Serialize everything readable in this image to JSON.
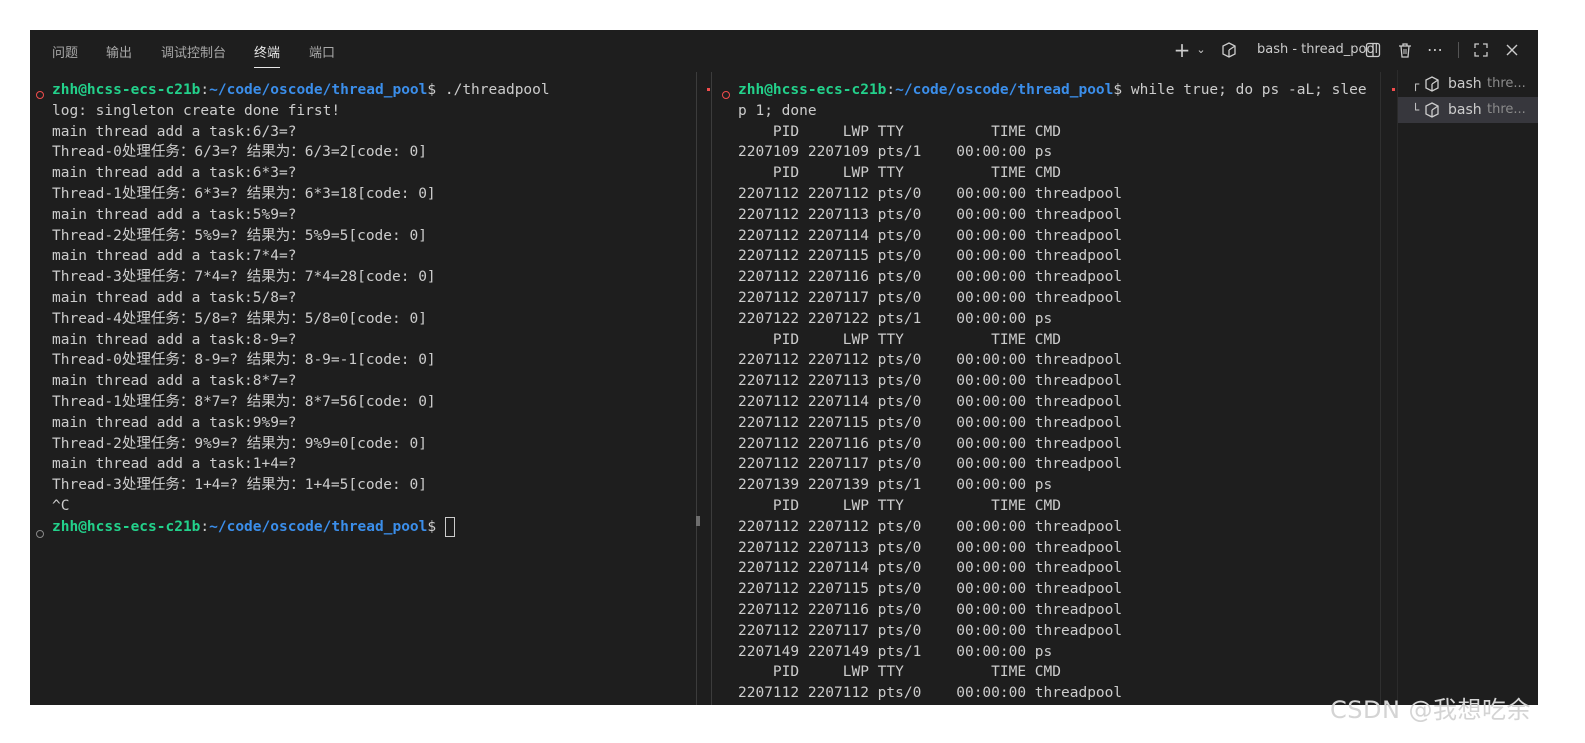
{
  "tabs": [
    {
      "label": "问题",
      "active": false
    },
    {
      "label": "输出",
      "active": false
    },
    {
      "label": "调试控制台",
      "active": false
    },
    {
      "label": "终端",
      "active": true
    },
    {
      "label": "端口",
      "active": false
    }
  ],
  "toolbar": {
    "terminal_name": "bash - thread_pool",
    "icons": [
      "plus-icon",
      "chevron-down-icon",
      "terminal-icon",
      "split-icon",
      "trash-icon",
      "more-icon",
      "maximize-icon",
      "close-icon"
    ]
  },
  "left_pane": {
    "prompt": {
      "user": "zhh@hcss-ecs-c21b",
      "path": "~/code/oscode/thread_pool",
      "suffix": "$"
    },
    "command": " ./threadpool",
    "output": [
      "log: singleton create done first!",
      "main thread add a task:6/3=?",
      "Thread-0处理任务：6/3=? 结果为：6/3=2[code: 0]",
      "main thread add a task:6*3=?",
      "Thread-1处理任务：6*3=? 结果为：6*3=18[code: 0]",
      "main thread add a task:5%9=?",
      "Thread-2处理任务：5%9=? 结果为：5%9=5[code: 0]",
      "main thread add a task:7*4=?",
      "Thread-3处理任务：7*4=? 结果为：7*4=28[code: 0]",
      "main thread add a task:5/8=?",
      "Thread-4处理任务：5/8=? 结果为：5/8=0[code: 0]",
      "main thread add a task:8-9=?",
      "Thread-0处理任务：8-9=? 结果为：8-9=-1[code: 0]",
      "main thread add a task:8*7=?",
      "Thread-1处理任务：8*7=? 结果为：8*7=56[code: 0]",
      "main thread add a task:9%9=?",
      "Thread-2处理任务：9%9=? 结果为：9%9=0[code: 0]",
      "main thread add a task:1+4=?",
      "Thread-3处理任务：1+4=? 结果为：1+4=5[code: 0]",
      "^C"
    ]
  },
  "right_pane": {
    "prompt": {
      "user": "zhh@hcss-ecs-c21b",
      "path": "~/code/oscode/thread_pool",
      "suffix": "$"
    },
    "command": " while true; do ps -aL; slee",
    "command_wrap": "p 1; done",
    "output": [
      "    PID     LWP TTY          TIME CMD",
      "2207109 2207109 pts/1    00:00:00 ps",
      "    PID     LWP TTY          TIME CMD",
      "2207112 2207112 pts/0    00:00:00 threadpool",
      "2207112 2207113 pts/0    00:00:00 threadpool",
      "2207112 2207114 pts/0    00:00:00 threadpool",
      "2207112 2207115 pts/0    00:00:00 threadpool",
      "2207112 2207116 pts/0    00:00:00 threadpool",
      "2207112 2207117 pts/0    00:00:00 threadpool",
      "2207122 2207122 pts/1    00:00:00 ps",
      "    PID     LWP TTY          TIME CMD",
      "2207112 2207112 pts/0    00:00:00 threadpool",
      "2207112 2207113 pts/0    00:00:00 threadpool",
      "2207112 2207114 pts/0    00:00:00 threadpool",
      "2207112 2207115 pts/0    00:00:00 threadpool",
      "2207112 2207116 pts/0    00:00:00 threadpool",
      "2207112 2207117 pts/0    00:00:00 threadpool",
      "2207139 2207139 pts/1    00:00:00 ps",
      "    PID     LWP TTY          TIME CMD",
      "2207112 2207112 pts/0    00:00:00 threadpool",
      "2207112 2207113 pts/0    00:00:00 threadpool",
      "2207112 2207114 pts/0    00:00:00 threadpool",
      "2207112 2207115 pts/0    00:00:00 threadpool",
      "2207112 2207116 pts/0    00:00:00 threadpool",
      "2207112 2207117 pts/0    00:00:00 threadpool",
      "2207149 2207149 pts/1    00:00:00 ps",
      "    PID     LWP TTY          TIME CMD",
      "2207112 2207112 pts/0    00:00:00 threadpool"
    ]
  },
  "terminal_list": [
    {
      "prefix": "┌",
      "name": "bash",
      "detail": "thre...",
      "selected": false
    },
    {
      "prefix": "└",
      "name": "bash",
      "detail": "thre...",
      "selected": true
    }
  ],
  "watermark": "CSDN @我想吃余",
  "colors": {
    "user": "#23d18b",
    "path": "#3b8eea",
    "background": "#1e1e1e",
    "text": "#cccccc"
  }
}
